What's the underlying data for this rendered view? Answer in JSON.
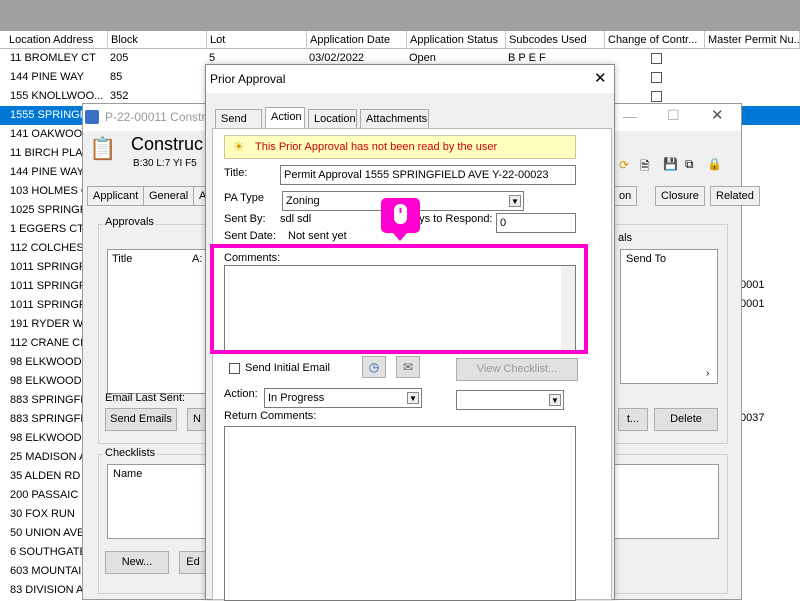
{
  "columns": [
    "Location Address",
    "Block",
    "Lot",
    "Application Date",
    "Application Status",
    "Subcodes Used",
    "Change of Contr...",
    "Master Permit Nu..."
  ],
  "rows": [
    {
      "addr": "11 BROMLEY CT",
      "block": "205",
      "lot": "5",
      "date": "03/02/2022",
      "status": "Open",
      "subcodes": "B P E F"
    },
    {
      "addr": "144 PINE WAY",
      "block": "85",
      "lot": "",
      "date": "",
      "status": "",
      "subcodes": ""
    },
    {
      "addr": "155 KNOLLWOO...",
      "block": "352",
      "lot": "",
      "date": "",
      "status": "",
      "subcodes": ""
    },
    {
      "addr": "1555 SPRINGFI",
      "block": "",
      "lot": "",
      "date": "",
      "status": "",
      "subcodes": ""
    },
    {
      "addr": "141 OAKWOOD",
      "block": "",
      "lot": "",
      "date": "",
      "status": "",
      "subcodes": ""
    },
    {
      "addr": "11 BIRCH PLAC",
      "block": "",
      "lot": "",
      "date": "",
      "status": "",
      "subcodes": ""
    },
    {
      "addr": "144 PINE WAY",
      "block": "",
      "lot": "",
      "date": "",
      "status": "",
      "subcodes": ""
    },
    {
      "addr": "103 HOLMES O",
      "block": "",
      "lot": "",
      "date": "",
      "status": "",
      "subcodes": ""
    },
    {
      "addr": "1025 SPRINGFI",
      "block": "",
      "lot": "",
      "date": "",
      "status": "",
      "subcodes": ""
    },
    {
      "addr": "1 EGGERS CT",
      "block": "",
      "lot": "",
      "date": "",
      "status": "",
      "subcodes": ""
    },
    {
      "addr": "112 COLCHEST",
      "block": "",
      "lot": "",
      "date": "",
      "status": "",
      "subcodes": ""
    },
    {
      "addr": "1011 SPRINGFI",
      "block": "",
      "lot": "",
      "date": "",
      "status": "",
      "subcodes": ""
    },
    {
      "addr": "1011 SPRINGFI",
      "block": "",
      "lot": "",
      "date": "",
      "status": "",
      "subcodes": ""
    },
    {
      "addr": "1011 SPRINGFI",
      "block": "",
      "lot": "",
      "date": "",
      "status": "",
      "subcodes": ""
    },
    {
      "addr": "191 RYDER WA",
      "block": "",
      "lot": "",
      "date": "",
      "status": "",
      "subcodes": ""
    },
    {
      "addr": "112 CRANE CI",
      "block": "",
      "lot": "",
      "date": "",
      "status": "",
      "subcodes": ""
    },
    {
      "addr": "98 ELKWOOD A",
      "block": "",
      "lot": "",
      "date": "",
      "status": "",
      "subcodes": ""
    },
    {
      "addr": "98 ELKWOOD A",
      "block": "",
      "lot": "",
      "date": "",
      "status": "",
      "subcodes": ""
    },
    {
      "addr": "883 SPRINGFIE",
      "block": "",
      "lot": "",
      "date": "",
      "status": "",
      "subcodes": ""
    },
    {
      "addr": "883 SPRINGFIE",
      "block": "",
      "lot": "",
      "date": "",
      "status": "",
      "subcodes": ""
    },
    {
      "addr": "98 ELKWOOD A",
      "block": "",
      "lot": "",
      "date": "",
      "status": "",
      "subcodes": ""
    },
    {
      "addr": "25 MADISON A",
      "block": "",
      "lot": "",
      "date": "",
      "status": "",
      "subcodes": ""
    },
    {
      "addr": "35 ALDEN RD",
      "block": "",
      "lot": "",
      "date": "",
      "status": "",
      "subcodes": ""
    },
    {
      "addr": "200 PASSAIC S",
      "block": "",
      "lot": "",
      "date": "",
      "status": "",
      "subcodes": ""
    },
    {
      "addr": "30 FOX RUN",
      "block": "",
      "lot": "",
      "date": "",
      "status": "",
      "subcodes": ""
    },
    {
      "addr": "50 UNION AVE",
      "block": "",
      "lot": "",
      "date": "",
      "status": "",
      "subcodes": ""
    },
    {
      "addr": "6 SOUTHGATE",
      "block": "",
      "lot": "",
      "date": "",
      "status": "",
      "subcodes": ""
    },
    {
      "addr": "603 MOUNTAIN",
      "block": "",
      "lot": "",
      "date": "",
      "status": "",
      "subcodes": ""
    },
    {
      "addr": "83 DIVISION A",
      "block": "",
      "lot": "",
      "date": "",
      "status": "",
      "subcodes": ""
    }
  ],
  "right_values": [
    "0001",
    "0001",
    "0037"
  ],
  "construction": {
    "window_title": "P-22-00011 Constru",
    "heading": "Construc",
    "subheading": "B:30 L:7  YI F5",
    "tabs": [
      "Applicant",
      "General",
      "A"
    ],
    "right_tabs": [
      "on",
      "Closure",
      "Related"
    ],
    "approvals_label": "Approvals",
    "title_col": "Title",
    "az_col": "A:",
    "als_label": "als",
    "send_to_col": "Send To",
    "email_last_sent": "Email Last Sent:",
    "send_emails": "Send Emails",
    "n_btn": "N",
    "t_btn": "t...",
    "delete_btn": "Delete",
    "checklists_label": "Checklists",
    "name_col": "Name",
    "new_btn": "New...",
    "ed_btn": "Ed"
  },
  "dialog": {
    "title": "Prior Approval",
    "tabs": [
      "Send To",
      "Action",
      "Location",
      "Attachments"
    ],
    "warning": "This Prior Approval has not been read by the user",
    "title_label": "Title:",
    "title_value": "Permit Approval 1555 SPRINGFIELD AVE Y-22-00023",
    "pa_type_label": "PA Type",
    "pa_type_value": "Zoning",
    "sent_by_label": "Sent By:",
    "sent_by_value": "sdl sdl",
    "days_label": "ays to Respond:",
    "days_value": "0",
    "sent_date_label": "Sent Date:",
    "sent_date_value": "Not sent yet",
    "comments_label": "Comments:",
    "send_initial_email": "Send Initial Email",
    "view_checklist": "View Checklist...",
    "action_label": "Action:",
    "action_value": "In Progress",
    "return_comments_label": "Return Comments:"
  }
}
